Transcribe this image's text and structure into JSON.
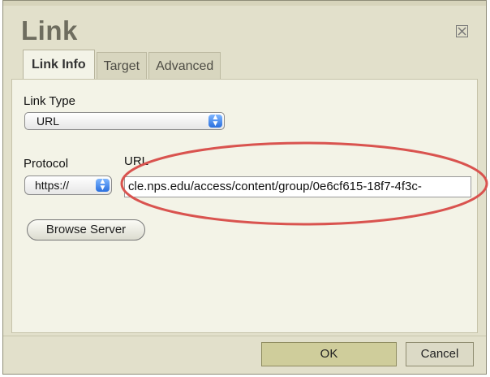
{
  "dialog": {
    "title": "Link",
    "close_icon": "close-icon",
    "tabs": [
      {
        "label": "Link Info",
        "active": true
      },
      {
        "label": "Target",
        "active": false
      },
      {
        "label": "Advanced",
        "active": false
      }
    ]
  },
  "link_info": {
    "link_type_label": "Link Type",
    "link_type_value": "URL",
    "protocol_label": "Protocol",
    "protocol_value": "https://",
    "url_label": "URL",
    "url_value": "cle.nps.edu/access/content/group/0e6cf615-18f7-4f3c-",
    "browse_server_label": "Browse Server"
  },
  "footer": {
    "ok_label": "OK",
    "cancel_label": "Cancel"
  },
  "colors": {
    "dialog_bg": "#e2e0cb",
    "panel_bg": "#f3f3e7",
    "ok_bg": "#cfcd9b",
    "highlight": "#d9534f"
  }
}
